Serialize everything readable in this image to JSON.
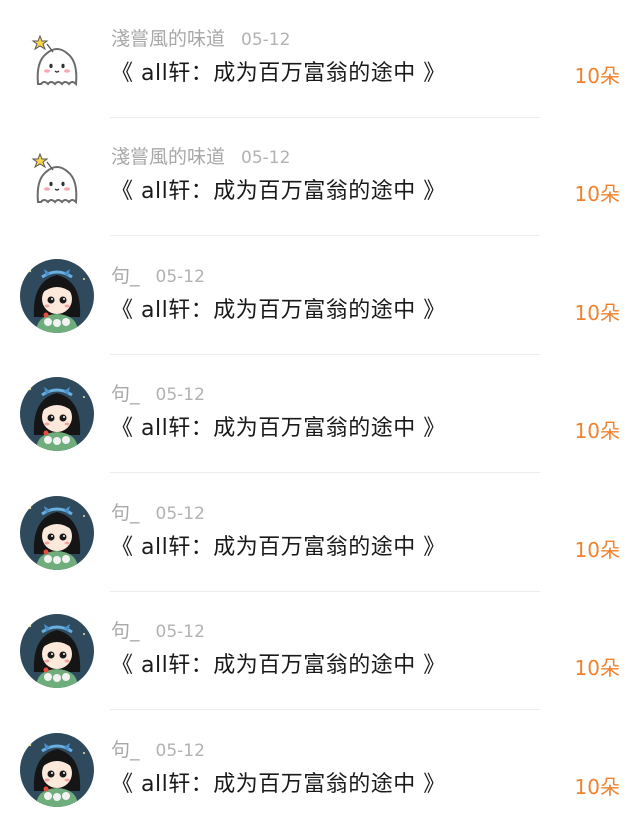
{
  "entries": [
    {
      "user": "淺嘗風的味道",
      "date": "05-12",
      "title": "《 all轩：成为百万富翁的途中 》",
      "count": "10朵",
      "avatar_icon": "ghost-star-icon"
    },
    {
      "user": "淺嘗風的味道",
      "date": "05-12",
      "title": "《 all轩：成为百万富翁的途中 》",
      "count": "10朵",
      "avatar_icon": "ghost-star-icon"
    },
    {
      "user": "句_",
      "date": "05-12",
      "title": "《 all轩：成为百万富翁的途中 》",
      "count": "10朵",
      "avatar_icon": "girl-avatar-icon"
    },
    {
      "user": "句_",
      "date": "05-12",
      "title": "《 all轩：成为百万富翁的途中 》",
      "count": "10朵",
      "avatar_icon": "girl-avatar-icon"
    },
    {
      "user": "句_",
      "date": "05-12",
      "title": "《 all轩：成为百万富翁的途中 》",
      "count": "10朵",
      "avatar_icon": "girl-avatar-icon"
    },
    {
      "user": "句_",
      "date": "05-12",
      "title": "《 all轩：成为百万富翁的途中 》",
      "count": "10朵",
      "avatar_icon": "girl-avatar-icon"
    },
    {
      "user": "句_",
      "date": "05-12",
      "title": "《 all轩：成为百万富翁的途中 》",
      "count": "10朵",
      "avatar_icon": "girl-avatar-icon"
    }
  ],
  "colors": {
    "count": "#f0822d",
    "username": "#a8a8a8",
    "title": "#1a1a1a"
  }
}
